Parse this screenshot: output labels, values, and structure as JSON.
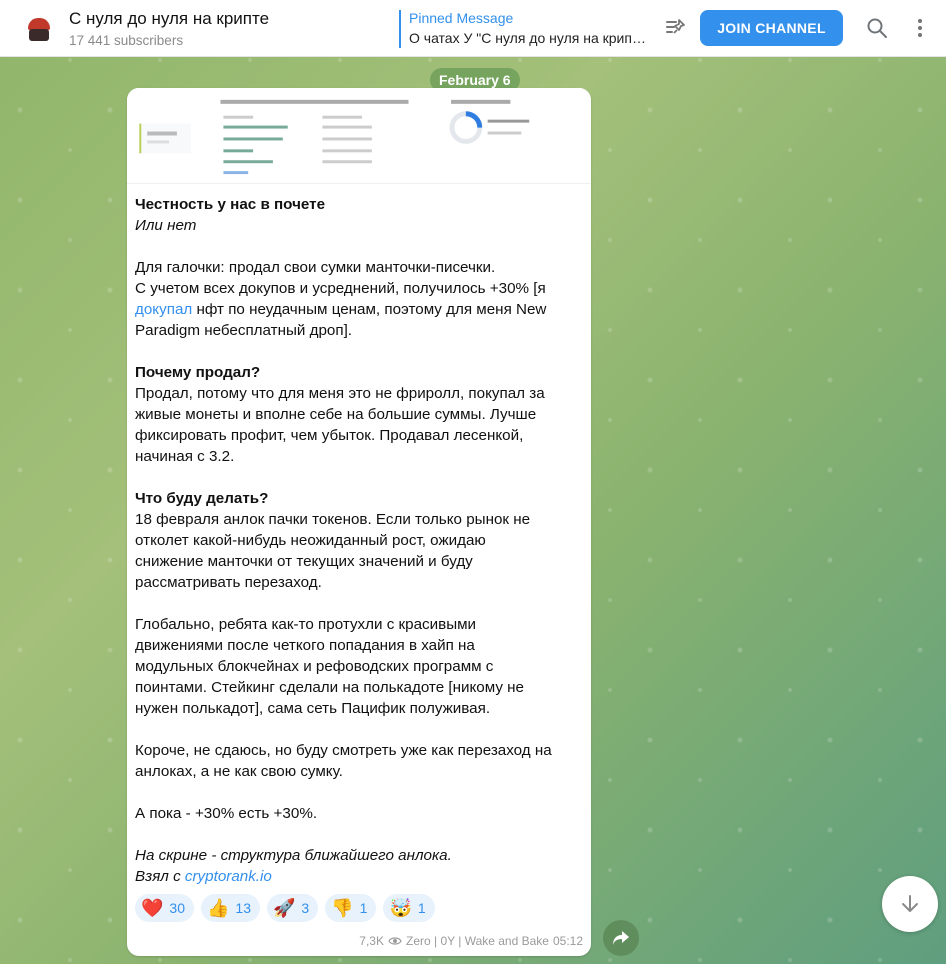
{
  "channel": {
    "title": "С нуля до нуля на крипте",
    "subscribers": "17 441 subscribers"
  },
  "pinned": {
    "label": "Pinned Message",
    "text": "О чатах У \"С нуля до нуля на крипт…"
  },
  "header": {
    "join_label": "JOIN CHANNEL"
  },
  "date_chip": "February 6",
  "post": {
    "lines": [
      {
        "style": "bold",
        "text": "Честность у нас в почете"
      },
      {
        "style": "italic",
        "text": "Или нет"
      },
      {
        "style": "gap",
        "text": ""
      },
      {
        "style": "plain",
        "text": "Для галочки: продал свои сумки манточки-писечки."
      },
      {
        "style": "plain",
        "text": "С учетом всех докупов и усреднений, получилось +30% [я"
      },
      {
        "style": "link-start",
        "text": " нфт по неудачным ценам, поэтому для меня New",
        "link": "докупал"
      },
      {
        "style": "plain",
        "text": "Paradigm небесплатный дроп]."
      },
      {
        "style": "gap",
        "text": ""
      },
      {
        "style": "bold",
        "text": "Почему продал?"
      },
      {
        "style": "plain",
        "text": "Продал, потому что для меня это не фриролл, покупал за"
      },
      {
        "style": "plain",
        "text": "живые монеты и вполне себе на большие суммы. Лучше"
      },
      {
        "style": "plain",
        "text": "фиксировать профит, чем убыток. Продавал лесенкой,"
      },
      {
        "style": "plain",
        "text": "начиная с 3.2."
      },
      {
        "style": "gap",
        "text": ""
      },
      {
        "style": "bold",
        "text": "Что буду делать?"
      },
      {
        "style": "plain",
        "text": "18 февраля анлок пачки токенов. Если только рынок не"
      },
      {
        "style": "plain",
        "text": "отколет какой-нибудь неожиданный рост, ожидаю"
      },
      {
        "style": "plain",
        "text": "снижение манточки от текущих значений и буду"
      },
      {
        "style": "plain",
        "text": "рассматривать перезаход."
      },
      {
        "style": "gap",
        "text": ""
      },
      {
        "style": "plain",
        "text": "Глобально, ребята как-то протухли с красивыми"
      },
      {
        "style": "plain",
        "text": "движениями после четкого попадания в хайп на"
      },
      {
        "style": "plain",
        "text": "модульных блокчейнах и рефоводских программ с"
      },
      {
        "style": "plain",
        "text": "поинтами. Стейкинг сделали на полькадоте [никому не"
      },
      {
        "style": "plain",
        "text": "нужен полькадот], сама сеть Пацифик полуживая."
      },
      {
        "style": "gap",
        "text": ""
      },
      {
        "style": "plain",
        "text": "Короче, не сдаюсь, но буду смотреть уже как перезаход на"
      },
      {
        "style": "plain",
        "text": "анлоках, а не как свою сумку."
      },
      {
        "style": "gap",
        "text": ""
      },
      {
        "style": "plain",
        "text": "А пока - +30% есть +30%."
      },
      {
        "style": "gap",
        "text": ""
      },
      {
        "style": "italic",
        "text": "На скрине - структура ближайшего анлока."
      },
      {
        "style": "italic-link",
        "text": "Взял с ",
        "link": "cryptorank.io"
      }
    ],
    "reactions": [
      {
        "emoji": "❤️",
        "count": "30"
      },
      {
        "emoji": "👍",
        "count": "13"
      },
      {
        "emoji": "🚀",
        "count": "3"
      },
      {
        "emoji": "👎",
        "count": "1"
      },
      {
        "emoji": "🤯",
        "count": "1"
      }
    ],
    "views": "7,3K",
    "author": "Zero | 0Y | Wake and Bake",
    "time": "05:12"
  },
  "colors": {
    "accent": "#3390ec",
    "chip": "#6ea05a"
  },
  "icons": {
    "pin": "pin-list-icon",
    "search": "search-icon",
    "more": "more-vertical-icon",
    "share": "share-icon",
    "scroll": "arrow-down-icon",
    "views": "eye-icon"
  }
}
